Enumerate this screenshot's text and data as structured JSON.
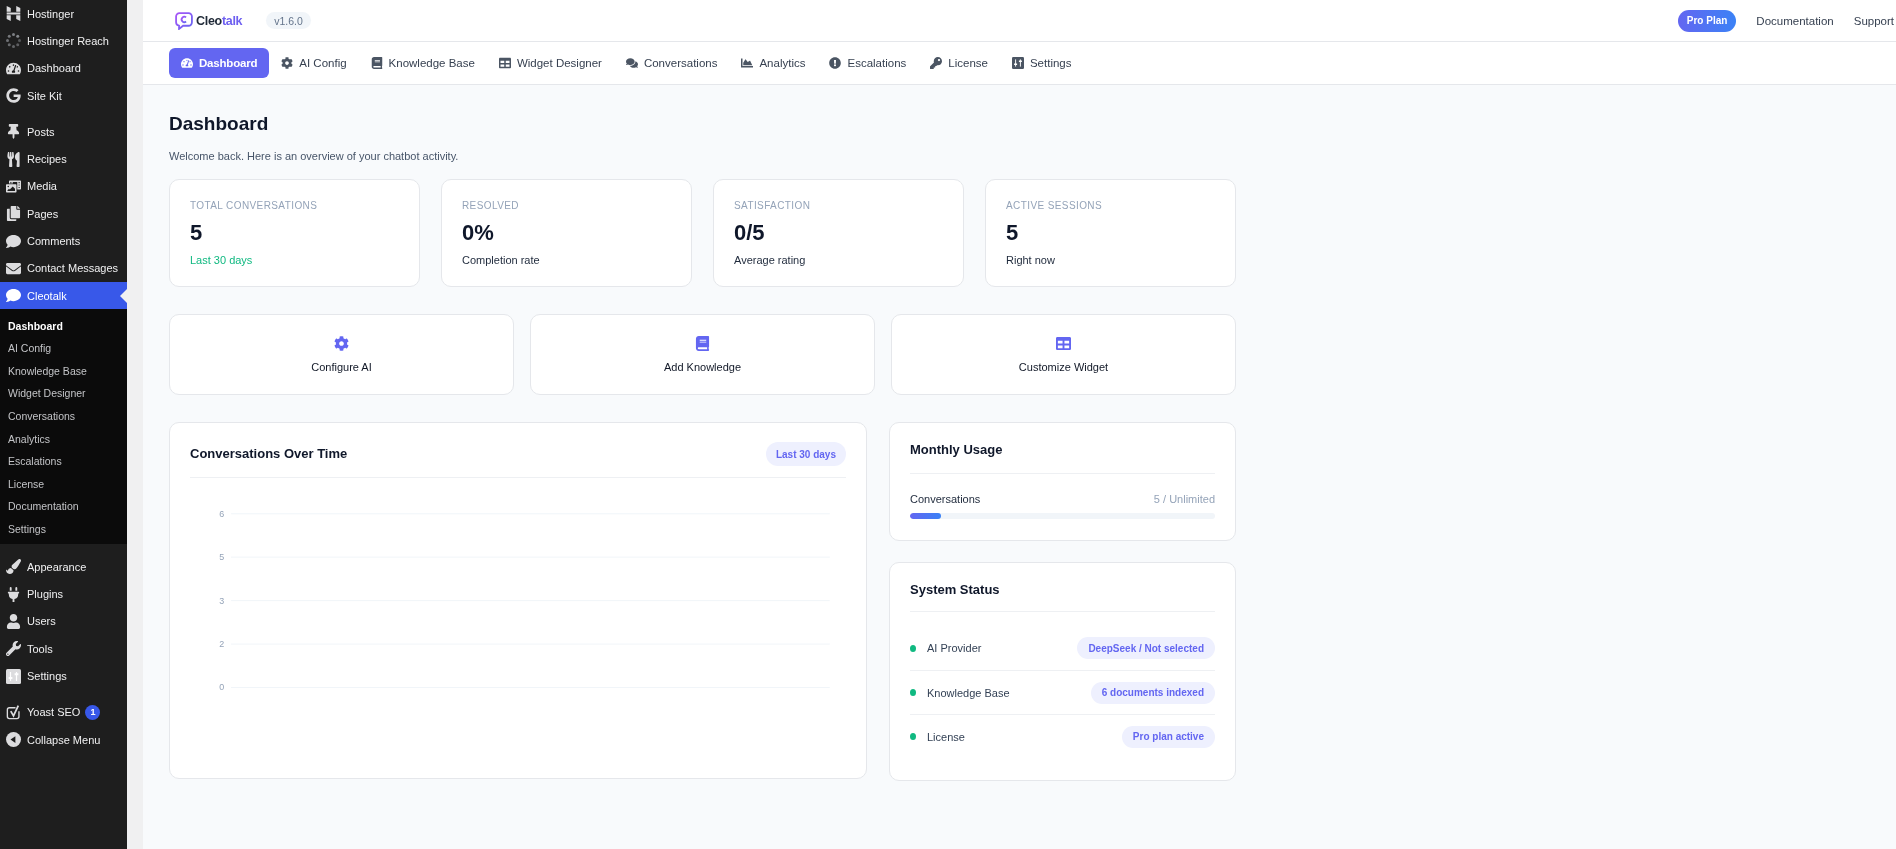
{
  "sidebar": {
    "groups": [
      {
        "items": [
          {
            "label": "Hostinger",
            "selected": false
          },
          {
            "label": "Hostinger Reach",
            "selected": false
          },
          {
            "label": "Dashboard",
            "selected": false
          },
          {
            "label": "Site Kit",
            "selected": false
          }
        ]
      },
      {
        "items": [
          {
            "label": "Posts",
            "selected": false
          },
          {
            "label": "Recipes",
            "selected": false
          },
          {
            "label": "Media",
            "selected": false
          },
          {
            "label": "Pages",
            "selected": false
          },
          {
            "label": "Comments",
            "selected": false
          },
          {
            "label": "Contact Messages",
            "selected": false
          },
          {
            "label": "Cleotalk",
            "selected": true,
            "children": [
              {
                "label": "Dashboard",
                "selected": true
              },
              {
                "label": "AI Config",
                "selected": false
              },
              {
                "label": "Knowledge Base",
                "selected": false
              },
              {
                "label": "Widget Designer",
                "selected": false
              },
              {
                "label": "Conversations",
                "selected": false
              },
              {
                "label": "Analytics",
                "selected": false
              },
              {
                "label": "Escalations",
                "selected": false
              },
              {
                "label": "License",
                "selected": false
              },
              {
                "label": "Documentation",
                "selected": false
              },
              {
                "label": "Settings",
                "selected": false
              }
            ]
          }
        ]
      },
      {
        "items": [
          {
            "label": "Appearance",
            "selected": false
          },
          {
            "label": "Plugins",
            "selected": false
          },
          {
            "label": "Users",
            "selected": false
          },
          {
            "label": "Tools",
            "selected": false
          },
          {
            "label": "Settings",
            "selected": false
          }
        ]
      },
      {
        "items": [
          {
            "label": "Yoast SEO",
            "selected": false,
            "badge": "1"
          },
          {
            "label": "Collapse Menu",
            "selected": false
          }
        ]
      }
    ]
  },
  "top_bar": {
    "logo": {
      "parts": [
        "Cleo",
        "talk"
      ]
    },
    "version": "v1.6.0",
    "plan_badge": "Pro Plan",
    "links": [
      "Documentation",
      "Support"
    ]
  },
  "tabs": [
    {
      "label": "Dashboard",
      "selected": true
    },
    {
      "label": "AI Config",
      "selected": false
    },
    {
      "label": "Knowledge Base",
      "selected": false
    },
    {
      "label": "Widget Designer",
      "selected": false
    },
    {
      "label": "Conversations",
      "selected": false
    },
    {
      "label": "Analytics",
      "selected": false
    },
    {
      "label": "Escalations",
      "selected": false
    },
    {
      "label": "License",
      "selected": false
    },
    {
      "label": "Settings",
      "selected": false
    }
  ],
  "page": {
    "title": "Dashboard",
    "subtitle": "Welcome back. Here is an overview of your chatbot activity."
  },
  "stats": [
    {
      "label": "TOTAL CONVERSATIONS",
      "value": "5",
      "note": "Last 30 days",
      "kind": "trend"
    },
    {
      "label": "RESOLVED",
      "value": "0%",
      "note": "Completion rate",
      "kind": "caption"
    },
    {
      "label": "SATISFACTION",
      "value": "0/5",
      "note": "Average rating",
      "kind": "caption"
    },
    {
      "label": "ACTIVE SESSIONS",
      "value": "5",
      "note": "Right now",
      "kind": "caption"
    }
  ],
  "quick_actions": [
    {
      "label": "Configure AI"
    },
    {
      "label": "Add Knowledge"
    },
    {
      "label": "Customize Widget"
    }
  ],
  "chart_panel": {
    "title": "Conversations Over Time",
    "badge": "Last 30 days",
    "axis_labels": [
      "6",
      "5",
      "3",
      "2",
      "0"
    ]
  },
  "usage": {
    "title": "Monthly Usage",
    "rows": [
      {
        "label": "Conversations",
        "reading": "5 / Unlimited",
        "level": 0.1
      }
    ]
  },
  "system_status": {
    "title": "System Status",
    "items": [
      {
        "label": "AI Provider",
        "value": "DeepSeek / Not selected",
        "color": "#10b981"
      },
      {
        "label": "Knowledge Base",
        "value": "6 documents indexed",
        "color": "#10b981"
      },
      {
        "label": "License",
        "value": "Pro plan active",
        "color": "#10b981"
      }
    ]
  }
}
